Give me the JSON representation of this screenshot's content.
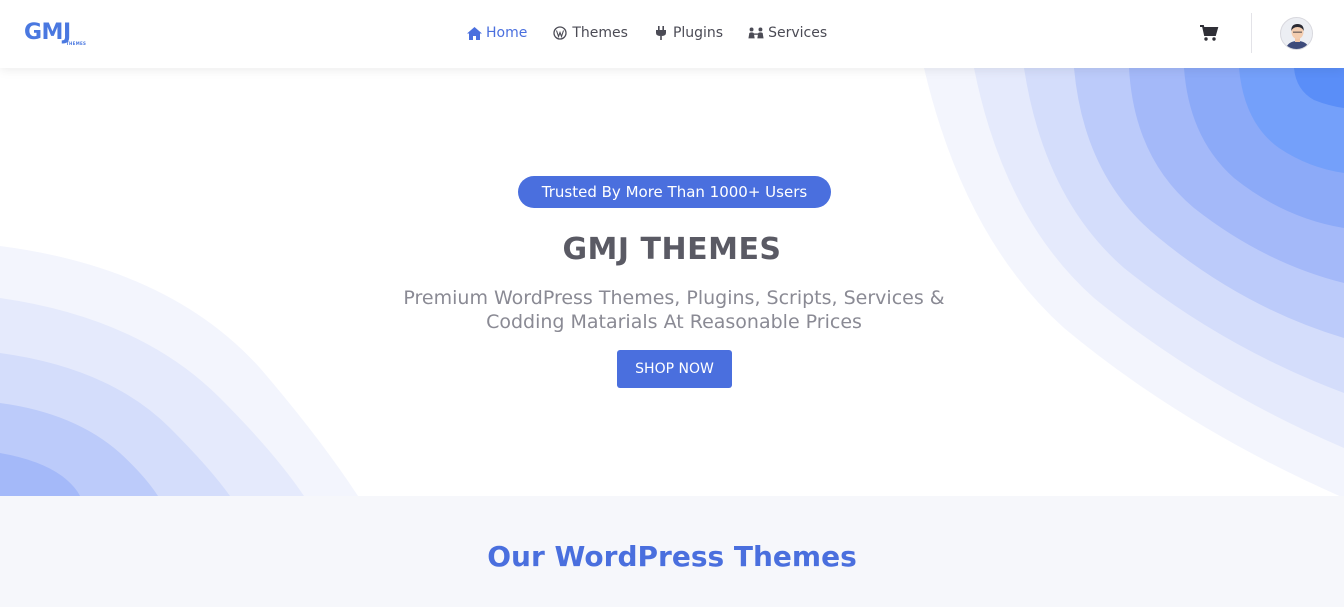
{
  "header": {
    "logo_text": "GMJ",
    "logo_subtext": "THEMES",
    "nav": [
      {
        "label": "Home",
        "icon": "home-icon",
        "active": true
      },
      {
        "label": "Themes",
        "icon": "wordpress-icon",
        "active": false
      },
      {
        "label": "Plugins",
        "icon": "plug-icon",
        "active": false
      },
      {
        "label": "Services",
        "icon": "people-icon",
        "active": false
      }
    ],
    "cart_icon": "cart-icon",
    "avatar_icon": "user-avatar"
  },
  "hero": {
    "badge": "Trusted By More Than 1000+ Users",
    "title": "GMJ THEMES",
    "subtitle": "Premium WordPress Themes, Plugins, Scripts, Services & Codding Matarials At Reasonable Prices",
    "cta_label": "SHOP NOW"
  },
  "section": {
    "title": "Our WordPress Themes"
  },
  "colors": {
    "accent": "#4a6fde",
    "heading": "#5a5a64",
    "muted": "#8a8a94",
    "section_bg": "#f6f7fb"
  }
}
